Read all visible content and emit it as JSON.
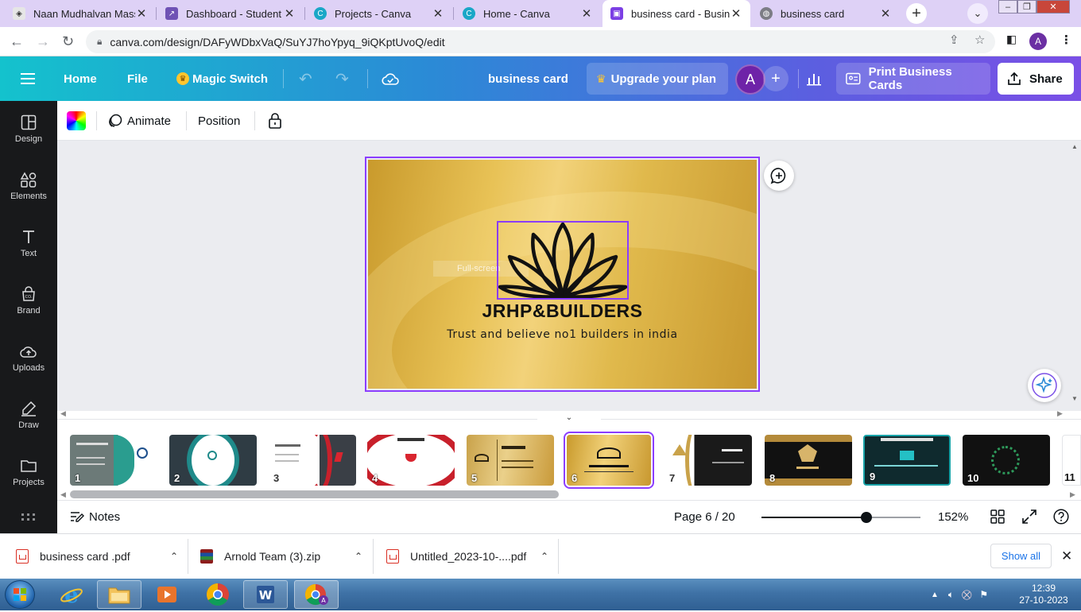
{
  "browser": {
    "tabs": [
      {
        "title": "Naan Mudhalvan Massi",
        "active": false
      },
      {
        "title": "Dashboard - Student",
        "active": false
      },
      {
        "title": "Projects - Canva",
        "active": false
      },
      {
        "title": "Home - Canva",
        "active": false
      },
      {
        "title": "business card - Business",
        "active": true
      },
      {
        "title": "business card",
        "active": false
      }
    ],
    "url": "canva.com/design/DAFyWDbxVaQ/SuYJ7hoYpyq_9iQKptUvoQ/edit",
    "profile_initial": "A"
  },
  "header": {
    "home": "Home",
    "file": "File",
    "magic_switch": "Magic Switch",
    "doc_title": "business card",
    "upgrade": "Upgrade your plan",
    "avatar_initial": "A",
    "print": "Print Business Cards",
    "share": "Share"
  },
  "sidebar": {
    "items": [
      {
        "label": "Design"
      },
      {
        "label": "Elements"
      },
      {
        "label": "Text"
      },
      {
        "label": "Brand"
      },
      {
        "label": "Uploads"
      },
      {
        "label": "Draw"
      },
      {
        "label": "Projects"
      }
    ]
  },
  "context_toolbar": {
    "animate": "Animate",
    "position": "Position"
  },
  "canvas": {
    "company_name": "JRHP&BUILDERS",
    "tagline": "Trust and believe no1 builders in india",
    "fullscreen_hint": "Full-screen"
  },
  "pages": {
    "numbers": [
      "1",
      "2",
      "3",
      "4",
      "5",
      "6",
      "7",
      "8",
      "9",
      "10",
      "11"
    ],
    "active_index": 5
  },
  "bottombar": {
    "notes": "Notes",
    "page_indicator": "Page 6 / 20",
    "zoom": "152%",
    "zoom_fraction": 0.66
  },
  "downloads": {
    "items": [
      {
        "name": "business card .pdf",
        "type": "pdf"
      },
      {
        "name": "Arnold Team (3).zip",
        "type": "zip"
      },
      {
        "name": "Untitled_2023-10-....pdf",
        "type": "pdf"
      }
    ],
    "show_all": "Show all"
  },
  "taskbar": {
    "time": "12:39",
    "date": "27-10-2023"
  },
  "colors": {
    "canva_purple": "#8b3dff",
    "header_start": "#14c2cd",
    "header_end": "#7a4fe6",
    "sidebar_bg": "#18191b",
    "card_gold": "#e8c256"
  }
}
